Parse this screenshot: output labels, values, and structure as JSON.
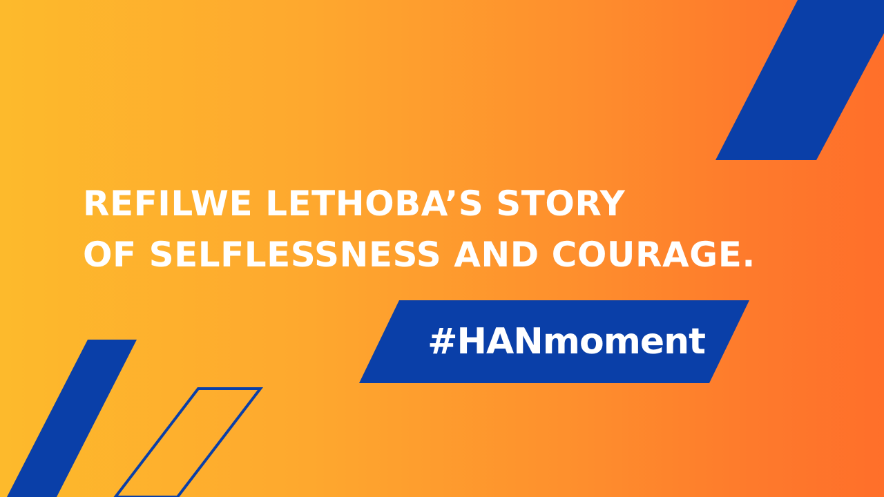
{
  "headline": {
    "line1": "REFILWE LETHOBA’S STORY",
    "line2": "OF SELFLESSNESS AND COURAGE."
  },
  "hashtag": {
    "label": "#HANmoment"
  },
  "colors": {
    "gradient_start": "#FDBA2C",
    "gradient_end": "#FF6F2A",
    "accent_blue": "#0A3FA8",
    "text": "#FFFFFF"
  }
}
